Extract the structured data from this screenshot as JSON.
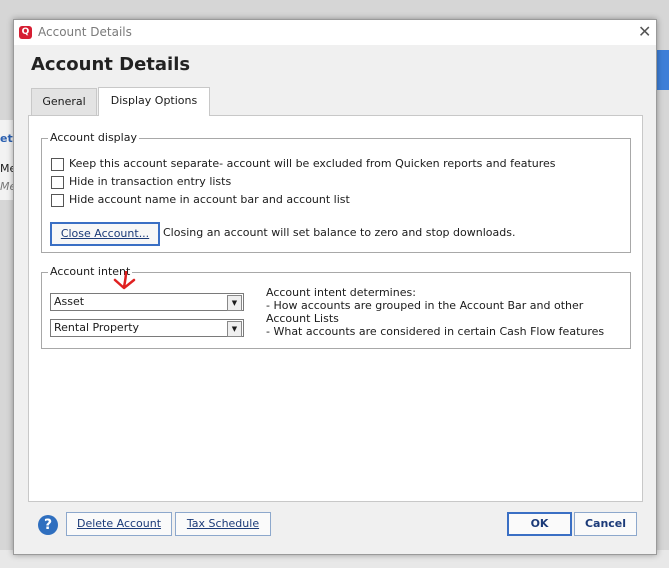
{
  "background": {
    "left_fragments": [
      "et",
      "Me",
      "Me"
    ]
  },
  "dialog": {
    "window_title": "Account Details",
    "heading": "Account Details",
    "app_icon_letter": "Q",
    "tabs": [
      {
        "label": "General",
        "selected": false
      },
      {
        "label": "Display Options",
        "selected": true
      }
    ],
    "account_display": {
      "legend": "Account display",
      "checkboxes": [
        {
          "label": "Keep this account separate- account will be excluded from Quicken reports and features",
          "checked": false
        },
        {
          "label": "Hide in transaction entry lists",
          "checked": false
        },
        {
          "label": "Hide account name in account bar and account list",
          "checked": false
        }
      ],
      "close_button_label": "Close Account...",
      "close_note": "Closing an account will set balance to zero and stop downloads."
    },
    "account_intent": {
      "legend": "Account intent",
      "select_type": "Asset",
      "select_subtype": "Rental Property",
      "info_title": "Account intent determines:",
      "info_line_1": "- How accounts are grouped in the Account Bar and other Account Lists",
      "info_line_2": "- What accounts are considered in certain Cash Flow features"
    },
    "footer": {
      "delete_label": "Delete Account",
      "tax_label": "Tax Schedule",
      "ok_label": "OK",
      "cancel_label": "Cancel"
    }
  },
  "colors": {
    "accent": "#3a6fc4",
    "app_icon": "#d61e32",
    "annotation": "#e02020"
  }
}
